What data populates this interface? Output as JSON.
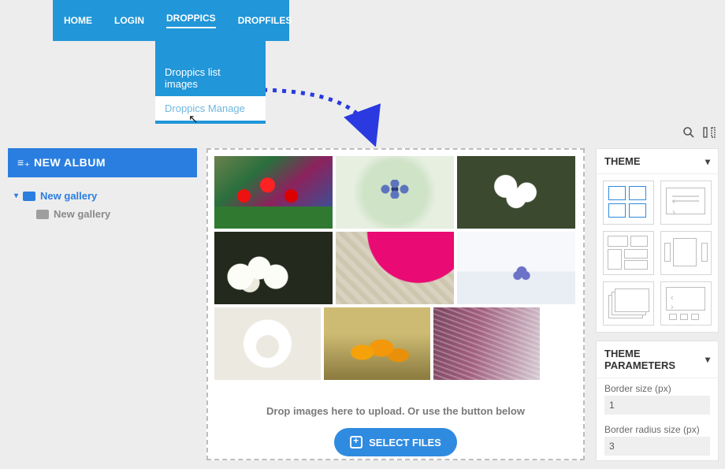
{
  "nav": {
    "items": [
      "HOME",
      "LOGIN",
      "DROPPICS",
      "DROPFILES"
    ],
    "active_index": 2,
    "dropdown": {
      "item1": "Droppics list images",
      "item2": "Droppics Manage"
    }
  },
  "sidebar": {
    "new_album": "NEW ALBUM",
    "tree": {
      "lvl1": "New gallery",
      "lvl2": "New gallery"
    }
  },
  "gallery": {
    "drop_text": "Drop images here to upload. Or use the button below",
    "select_btn": "SELECT FILES"
  },
  "right": {
    "theme_title": "THEME",
    "params_title": "THEME PARAMETERS",
    "border_size_label": "Border size (px)",
    "border_size_value": "1",
    "border_radius_label": "Border radius size (px)",
    "border_radius_value": "3"
  },
  "icons": {
    "search": "search-icon",
    "columns": "columns-icon"
  }
}
